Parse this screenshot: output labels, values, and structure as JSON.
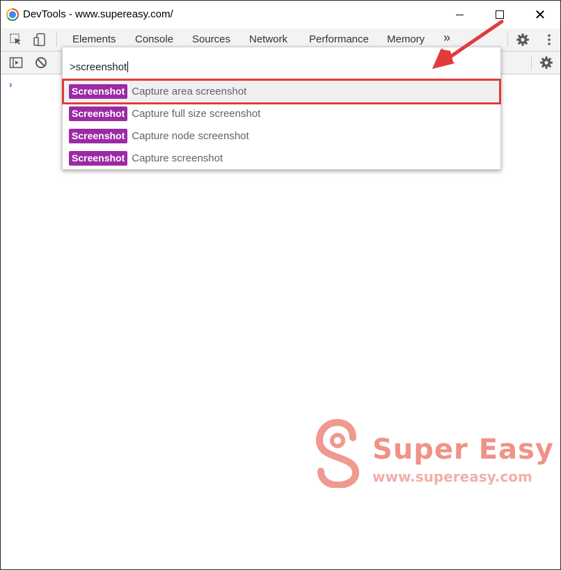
{
  "window": {
    "title": "DevTools - www.supereasy.com/",
    "controls": {
      "close": "✕"
    }
  },
  "tabs": [
    {
      "label": "Elements"
    },
    {
      "label": "Console"
    },
    {
      "label": "Sources"
    },
    {
      "label": "Network"
    },
    {
      "label": "Performance"
    },
    {
      "label": "Memory"
    }
  ],
  "tabs_overflow": "»",
  "console": {
    "prompt": "›"
  },
  "command_menu": {
    "input_value": ">screenshot",
    "items": [
      {
        "badge": "Screenshot",
        "label": "Capture area screenshot",
        "selected": true
      },
      {
        "badge": "Screenshot",
        "label": "Capture full size screenshot",
        "selected": false
      },
      {
        "badge": "Screenshot",
        "label": "Capture node screenshot",
        "selected": false
      },
      {
        "badge": "Screenshot",
        "label": "Capture screenshot",
        "selected": false
      }
    ]
  },
  "watermark": {
    "title": "Super Easy",
    "url": "www.supereasy.com"
  },
  "colors": {
    "badge": "#9b2aa4",
    "annotation": "#e23b3b",
    "watermark": "#e96e60"
  },
  "icons": [
    "chrome-icon",
    "inspect-element-icon",
    "device-toolbar-icon",
    "settings-icon",
    "more-vertical-icon",
    "sidebar-toggle-icon",
    "clear-console-icon",
    "console-settings-icon"
  ]
}
